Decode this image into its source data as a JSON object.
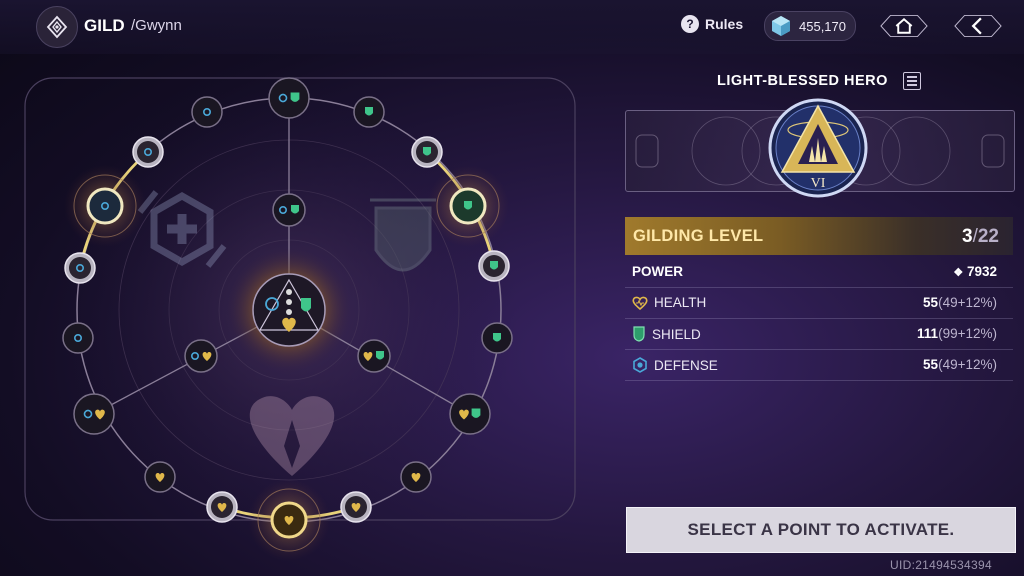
{
  "header": {
    "title": "GILD",
    "subtitle": "/Gwynn",
    "rules_label": "Rules",
    "currency_amount": "455,170",
    "currency_icon": "crystal-cube-icon"
  },
  "hero": {
    "name": "LIGHT-BLESSED HERO",
    "rank": "VI"
  },
  "gilding": {
    "label": "GILDING LEVEL",
    "current": "3",
    "max": "22",
    "separator": "/"
  },
  "stats": {
    "power": {
      "label": "POWER",
      "value": "7932"
    },
    "rows": [
      {
        "label": "HEALTH",
        "value": "55",
        "bonus": "(49+12%)",
        "icon": "heart-icon",
        "color": "#e0b84a"
      },
      {
        "label": "SHIELD",
        "value": "111",
        "bonus": "(99+12%)",
        "icon": "shield-icon",
        "color": "#3fc58a"
      },
      {
        "label": "DEFENSE",
        "value": "55",
        "bonus": "(49+12%)",
        "icon": "defense-icon",
        "color": "#4aa8d8"
      }
    ]
  },
  "action": {
    "label": "SELECT A POINT TO ACTIVATE."
  },
  "footer": {
    "uid": "UID:21494534394"
  },
  "colors": {
    "gold": "#e0b84a",
    "shield_green": "#3fc58a",
    "defense_blue": "#4aa8d8",
    "panel_bg": "#24173f"
  },
  "tree": {
    "nodes": [
      {
        "name": "node-top",
        "type": "defense-shield"
      },
      {
        "name": "node-inner-top",
        "type": "defense-shield"
      },
      {
        "name": "node-center",
        "type": "core"
      },
      {
        "name": "node-left-active",
        "type": "defense",
        "state": "active"
      },
      {
        "name": "node-right-active",
        "type": "shield",
        "state": "active"
      },
      {
        "name": "node-bottom-active",
        "type": "health",
        "state": "active"
      }
    ]
  }
}
